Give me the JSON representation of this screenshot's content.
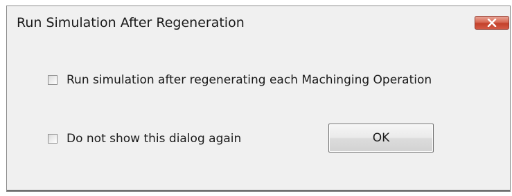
{
  "window": {
    "title": "Run Simulation After Regeneration",
    "close_icon": "close-icon"
  },
  "options": {
    "run_simulation": {
      "label": "Run simulation after regenerating each Machinging Operation",
      "checked": false
    },
    "do_not_show": {
      "label": "Do not show this dialog again",
      "checked": false
    }
  },
  "buttons": {
    "ok_label": "OK"
  },
  "colors": {
    "dialog_background": "#f0f0f0",
    "close_button_red": "#c3412b"
  }
}
